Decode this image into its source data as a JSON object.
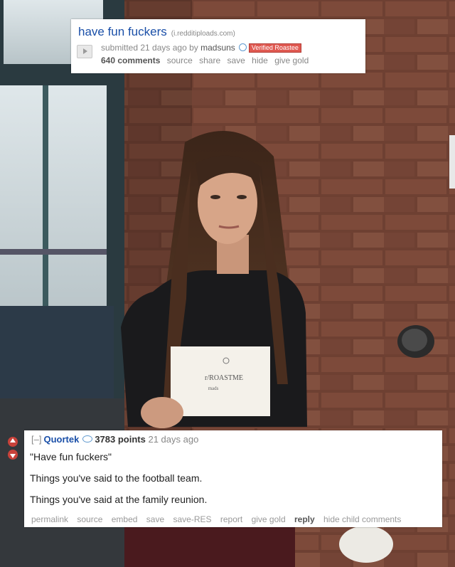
{
  "post": {
    "title": "have fun fuckers",
    "domain": "(i.redditiploads.com)",
    "submitted": "submitted 21 days ago by",
    "author": "madsuns",
    "flair": "Verified Roastee",
    "buttons": {
      "comments": "640 comments",
      "source": "source",
      "share": "share",
      "save": "save",
      "hide": "hide",
      "give_gold": "give gold"
    }
  },
  "sign": {
    "line1": "r/ROASTME",
    "line2": "mads"
  },
  "comment": {
    "toggle": "[–]",
    "author": "Quortek",
    "points": "3783 points",
    "age": "21 days ago",
    "lines": [
      "\"Have fun fuckers\"",
      "Things you've said to the football team.",
      "Things you've said at the family reunion."
    ],
    "buttons": {
      "permalink": "permalink",
      "source": "source",
      "embed": "embed",
      "save": "save",
      "save_res": "save-RES",
      "report": "report",
      "give_gold": "give gold",
      "reply": "reply",
      "hide_child": "hide child comments"
    }
  },
  "colors": {
    "link": "#1a4fa8",
    "flair_bg": "#e05a52",
    "upvote": "#c8423a",
    "brick": "#7a4a3a"
  }
}
